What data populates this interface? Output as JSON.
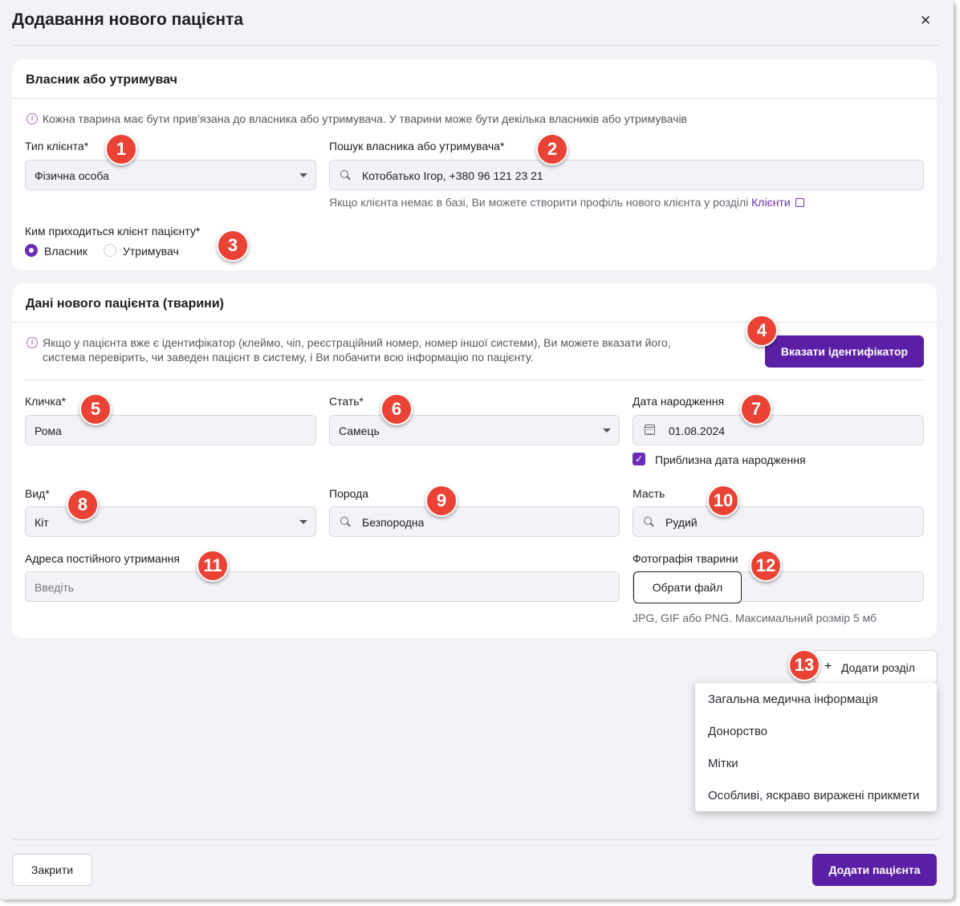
{
  "dialog": {
    "title": "Додавання нового пацієнта",
    "close_icon": "✕"
  },
  "owner_section": {
    "title": "Власник або утримувач",
    "info": "Кожна тварина має бути прив’язана до власника або утримувача. У тварини може бути декілька власників або утримувачів",
    "client_type": {
      "label": "Тип клієнта*",
      "value": "Фізична особа"
    },
    "owner_search": {
      "label": "Пошук власника або утримувача*",
      "value": "Котобатько Ігор, +380 96 121 23 21"
    },
    "hint": "Якщо клієнта немає в базі, Ви можете створити профіль нового клієнта у розділі",
    "hint_link": "Клієнти",
    "relation": {
      "label": "Ким приходиться клієнт пацієнту*",
      "options": [
        "Власник",
        "Утримувач"
      ],
      "selected": "Власник"
    }
  },
  "patient_section": {
    "title": "Дані нового пацієнта (тварини)",
    "info_line1": "Якщо у пацієнта вже є ідентифікатор (клеймо, чіп, реєстраційний номер, номер іншої системи), Ви можете вказати його,",
    "info_line2": "система перевірить, чи заведен пацієнт в систему, і Ви побачити всю інформацію по пацієнту.",
    "identifier_button": "Вказати ідентифікатор",
    "name": {
      "label": "Кличка*",
      "value": "Рома"
    },
    "sex": {
      "label": "Стать*",
      "value": "Самець"
    },
    "birth_date": {
      "label": "Дата народження",
      "value": "01.08.2024"
    },
    "approx_date": {
      "label": "Приблизна дата народження",
      "checked": true
    },
    "species": {
      "label": "Вид*",
      "value": "Кіт"
    },
    "breed": {
      "label": "Порода",
      "value": "Безпородна"
    },
    "color": {
      "label": "Масть",
      "value": "Рудий"
    },
    "address": {
      "label": "Адреса постійного утримання",
      "placeholder": "Введіть"
    },
    "photo": {
      "label": "Фотографія тварини",
      "button": "Обрати файл",
      "hint": "JPG, GIF або PNG. Максимальний розмір 5 мб"
    }
  },
  "add_section": {
    "button": "Додати розділ",
    "plus": "+",
    "menu": [
      "Загальна медична інформація",
      "Донорство",
      "Мітки",
      "Особливі, яскраво виражені прикмети"
    ]
  },
  "footer": {
    "close_button": "Закрити",
    "submit_button": "Додати пацієнта"
  },
  "annotations": [
    "1",
    "2",
    "3",
    "4",
    "5",
    "6",
    "7",
    "8",
    "9",
    "10",
    "11",
    "12",
    "13"
  ],
  "colors": {
    "accent": "#5b1fa6",
    "badge": "#ea4335",
    "background": "#f3f2f7"
  }
}
